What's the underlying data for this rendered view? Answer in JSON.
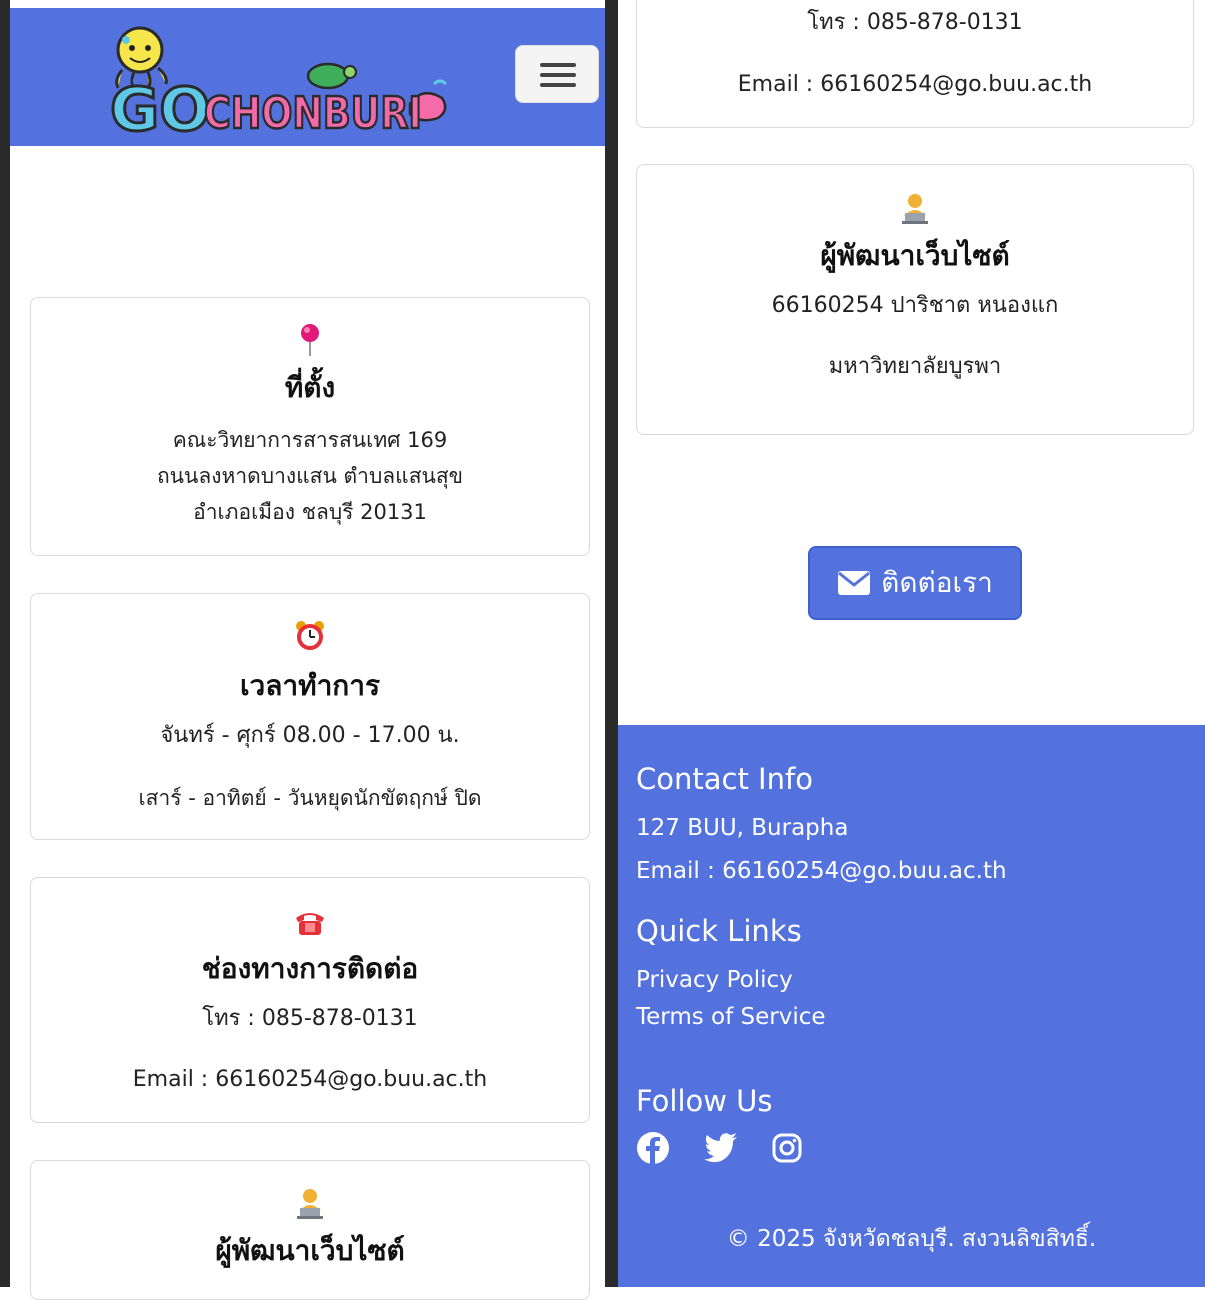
{
  "navbar": {
    "logo_text": "GO CHONBURI",
    "menu_icon": "hamburger-icon",
    "brand_color": "#5472de"
  },
  "location_card": {
    "icon": "pushpin-icon",
    "title": "ที่ตั้ง",
    "lines": [
      "คณะวิทยาการสารสนเทศ 169",
      "ถนนลงหาดบางแสน ตำบลแสนสุข",
      "อำเภอเมือง ชลบุรี 20131"
    ]
  },
  "hours_card": {
    "icon": "alarm-clock-icon",
    "title": "เวลาทำการ",
    "weekday": "จันทร์ - ศุกร์ 08.00 - 17.00 น.",
    "weekend": "เสาร์ - อาทิตย์ - วันหยุดนักขัตฤกษ์ ปิด"
  },
  "contact_card": {
    "icon": "telephone-icon",
    "title": "ช่องทางการติดต่อ",
    "phone": "โทร : 085-878-0131",
    "email": "Email : 66160254@go.buu.ac.th"
  },
  "developer_card": {
    "icon": "developer-icon",
    "title": "ผู้พัฒนาเว็บไซต์",
    "name": "66160254 ปาริชาต หนองแก",
    "university": "มหาวิทยาลัยบูรพา"
  },
  "contact_button": {
    "icon": "envelope-icon",
    "label": "ติดต่อเรา"
  },
  "footer": {
    "contact_heading": "Contact Info",
    "address": "127 BUU, Burapha",
    "email": "Email : 66160254@go.buu.ac.th",
    "links_heading": "Quick Links",
    "links": [
      "Privacy Policy",
      "Terms of Service"
    ],
    "follow_heading": "Follow Us",
    "socials": [
      "facebook-icon",
      "twitter-icon",
      "instagram-icon"
    ],
    "copyright": "© 2025 จังหวัดชลบุรี. สงวนลิขสิทธิ์."
  }
}
